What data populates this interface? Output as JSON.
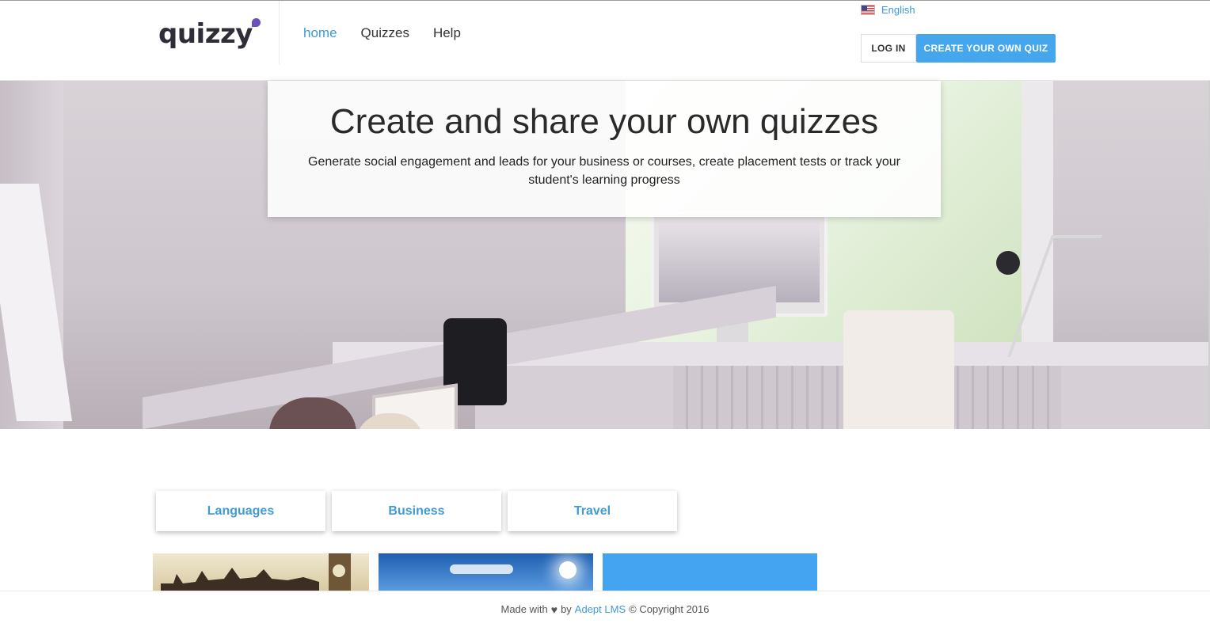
{
  "header": {
    "logo_text": "quizzy",
    "nav": [
      {
        "label": "home",
        "active": true
      },
      {
        "label": "Quizzes",
        "active": false
      },
      {
        "label": "Help",
        "active": false
      }
    ],
    "language": "English",
    "login_label": "LOG IN",
    "create_label": "CREATE YOUR OWN QUIZ"
  },
  "hero": {
    "title": "Create and share your own quizzes",
    "subtitle": "Generate social engagement and leads for your business or courses, create placement tests or track your student's learning progress"
  },
  "categories": [
    "Languages",
    "Business",
    "Travel"
  ],
  "footer": {
    "made_with": "Made with",
    "by": "by",
    "brand": "Adept LMS",
    "copyright": "© Copyright 2016"
  },
  "colors": {
    "accent": "#45a6ee",
    "link": "#3f9ad6",
    "logo_dot": "#6b4fbb"
  }
}
